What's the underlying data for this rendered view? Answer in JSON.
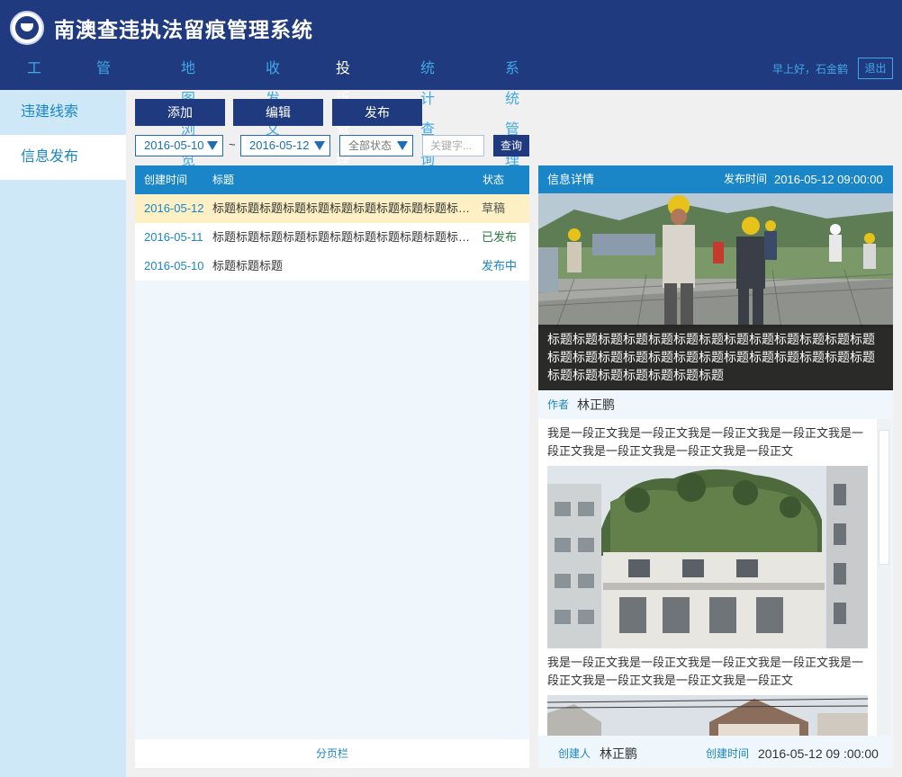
{
  "header": {
    "title": "南澳查违执法留痕管理系统",
    "greeting": "早上好，石金鹤",
    "logout": "退出",
    "nav": [
      {
        "label": "工作台"
      },
      {
        "label": "管理中心"
      },
      {
        "label": "地图浏览"
      },
      {
        "label": "收发文"
      },
      {
        "label": "投诉管理",
        "active": true
      },
      {
        "label": "统计查询"
      },
      {
        "label": "系统管理"
      }
    ]
  },
  "sidebar": {
    "items": [
      {
        "label": "违建线索"
      },
      {
        "label": "信息发布",
        "active": true
      }
    ]
  },
  "toolbar": {
    "add": "添加",
    "edit": "编辑",
    "publish": "发布"
  },
  "filters": {
    "date_from": "2016-05-10",
    "tilde": "~",
    "date_to": "2016-05-12",
    "status": "全部状态",
    "keyword_placeholder": "关键字...",
    "query": "查询"
  },
  "list": {
    "columns": {
      "created": "创建时间",
      "title": "标题",
      "status": "状态"
    },
    "rows": [
      {
        "date": "2016-05-12",
        "title": "标题标题标题标题标题标题标题标题标题标题标题...",
        "status": "草稿",
        "status_color": "#555555"
      },
      {
        "date": "2016-05-11",
        "title": "标题标题标题标题标题标题标题标题标题标题标题...",
        "status": "已发布",
        "status_color": "#2c7a3f"
      },
      {
        "date": "2016-05-10",
        "title": "标题标题标题",
        "status": "发布中",
        "status_color": "#1a86c8"
      }
    ],
    "pager": "分页栏"
  },
  "detail": {
    "header": "信息详情",
    "publish_label": "发布时间",
    "publish_time": "2016-05-12  09:00:00",
    "hero_caption": "标题标题标题标题标题标题标题标题标题标题标题标题标题标题标题标题标题标题标题标题标题标题标题标题标题标题标题标题标题标题标题标题标题",
    "author_label": "作者",
    "author": "林正鹏",
    "para1": "我是一段正文我是一段正文我是一段正文我是一段正文我是一段正文我是一段正文我是一段正文我是一段正文",
    "para2": "我是一段正文我是一段正文我是一段正文我是一段正文我是一段正文我是一段正文我是一段正文我是一段正文",
    "creator_label": "创建人",
    "creator": "林正鹏",
    "created_label": "创建时间",
    "created_time": "2016-05-12  09 :00:00"
  },
  "colors": {
    "header_bg": "#1f3a7e",
    "nav_inactive": "#42a7e6",
    "accent": "#1a86c8",
    "selected_row": "#fcf0c4"
  }
}
